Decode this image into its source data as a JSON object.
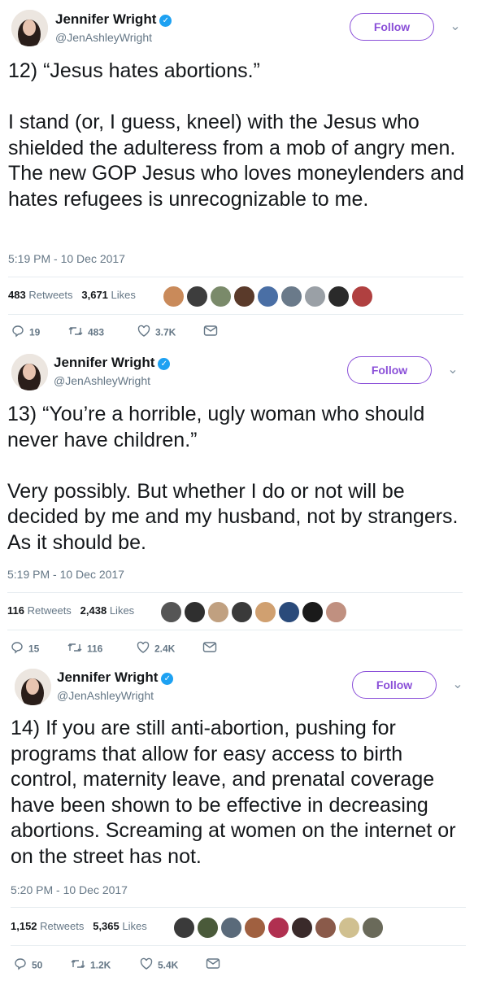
{
  "tweets": [
    {
      "user": {
        "name": "Jennifer Wright",
        "handle": "@JenAshleyWright"
      },
      "follow_label": "Follow",
      "text": "12) “Jesus hates abortions.”\n\nI stand (or, I guess, kneel) with the Jesus who shielded the adulteress from a mob of angry men. The new GOP Jesus who loves moneylenders and hates refugees is unrecognizable to me.",
      "timestamp": "5:19 PM - 10 Dec 2017",
      "retweets": "483",
      "retweets_label": "Retweets",
      "likes": "3,671",
      "likes_label": "Likes",
      "replies": "19",
      "rt_count": "483",
      "like_count": "3.7K"
    },
    {
      "user": {
        "name": "Jennifer Wright",
        "handle": "@JenAshleyWright"
      },
      "follow_label": "Follow",
      "text": "13) “You’re a horrible, ugly woman who should never have children.”\n\nVery possibly. But whether I do or not will be decided by me and my husband, not by strangers. As it should be.",
      "timestamp": "5:19 PM - 10 Dec 2017",
      "retweets": "116",
      "retweets_label": "Retweets",
      "likes": "2,438",
      "likes_label": "Likes",
      "replies": "15",
      "rt_count": "116",
      "like_count": "2.4K"
    },
    {
      "user": {
        "name": "Jennifer Wright",
        "handle": "@JenAshleyWright"
      },
      "follow_label": "Follow",
      "text": "14) If you are still anti-abortion, pushing for programs that allow for easy access to birth control, maternity leave, and prenatal coverage have been shown to be effective in decreasing abortions. Screaming at women on the internet or on the street has not.",
      "timestamp": "5:20 PM - 10 Dec 2017",
      "retweets": "1,152",
      "retweets_label": "Retweets",
      "likes": "5,365",
      "likes_label": "Likes",
      "replies": "50",
      "rt_count": "1.2K",
      "like_count": "5.4K"
    }
  ],
  "colors": {
    "follow_accent": "#8a4fd8",
    "verified": "#1da1f2",
    "secondary_text": "#657786",
    "divider": "#e6ecf0",
    "liker_avatars": [
      [
        "#c98a5a",
        "#3d3d3d",
        "#7a8a6a",
        "#5a3a2a",
        "#4a6fa5",
        "#6a7a8a",
        "#9aa0a6",
        "#2a2a2a",
        "#b04040"
      ],
      [
        "#555555",
        "#2f2f2f",
        "#c0a080",
        "#3a3a3a",
        "#d0a070",
        "#2a4a7a",
        "#1a1a1a",
        "#c09080"
      ],
      [
        "#3a3a3a",
        "#4a5a3a",
        "#5a6a7a",
        "#a06040",
        "#b03050",
        "#3a2a2a",
        "#8a5a4a",
        "#d0c090",
        "#6a6a5a"
      ]
    ]
  },
  "icons": [
    "verified-badge-icon",
    "chevron-down-icon",
    "reply-icon",
    "retweet-icon",
    "like-icon",
    "message-icon"
  ]
}
